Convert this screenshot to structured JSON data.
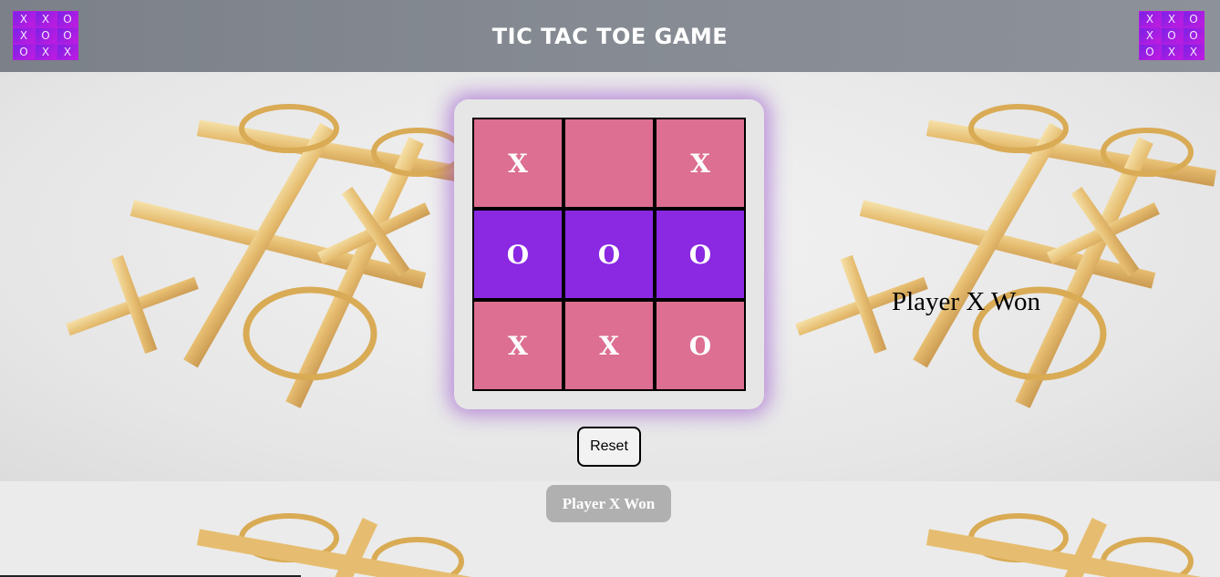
{
  "header": {
    "title": "TIC TAC TOE GAME",
    "logo_marks": [
      "X",
      "X",
      "O",
      "X",
      "O",
      "O",
      "O",
      "X",
      "X"
    ]
  },
  "board": {
    "cells": [
      {
        "mark": "X",
        "color": "#dc6f92"
      },
      {
        "mark": "",
        "color": "#dc6f92"
      },
      {
        "mark": "X",
        "color": "#dc6f92"
      },
      {
        "mark": "O",
        "color": "#8a28e2"
      },
      {
        "mark": "O",
        "color": "#8a28e2"
      },
      {
        "mark": "O",
        "color": "#8a28e2"
      },
      {
        "mark": "X",
        "color": "#dc6f92"
      },
      {
        "mark": "X",
        "color": "#dc6f92"
      },
      {
        "mark": "O",
        "color": "#dc6f92"
      }
    ]
  },
  "controls": {
    "reset_label": "Reset"
  },
  "status": {
    "badge_text": "Player X Won",
    "side_text": "Player X Won"
  },
  "colors": {
    "header": "#868b93",
    "cell_pink": "#dc6f92",
    "cell_purple": "#8a28e2",
    "glow": "#8c3cc8"
  }
}
